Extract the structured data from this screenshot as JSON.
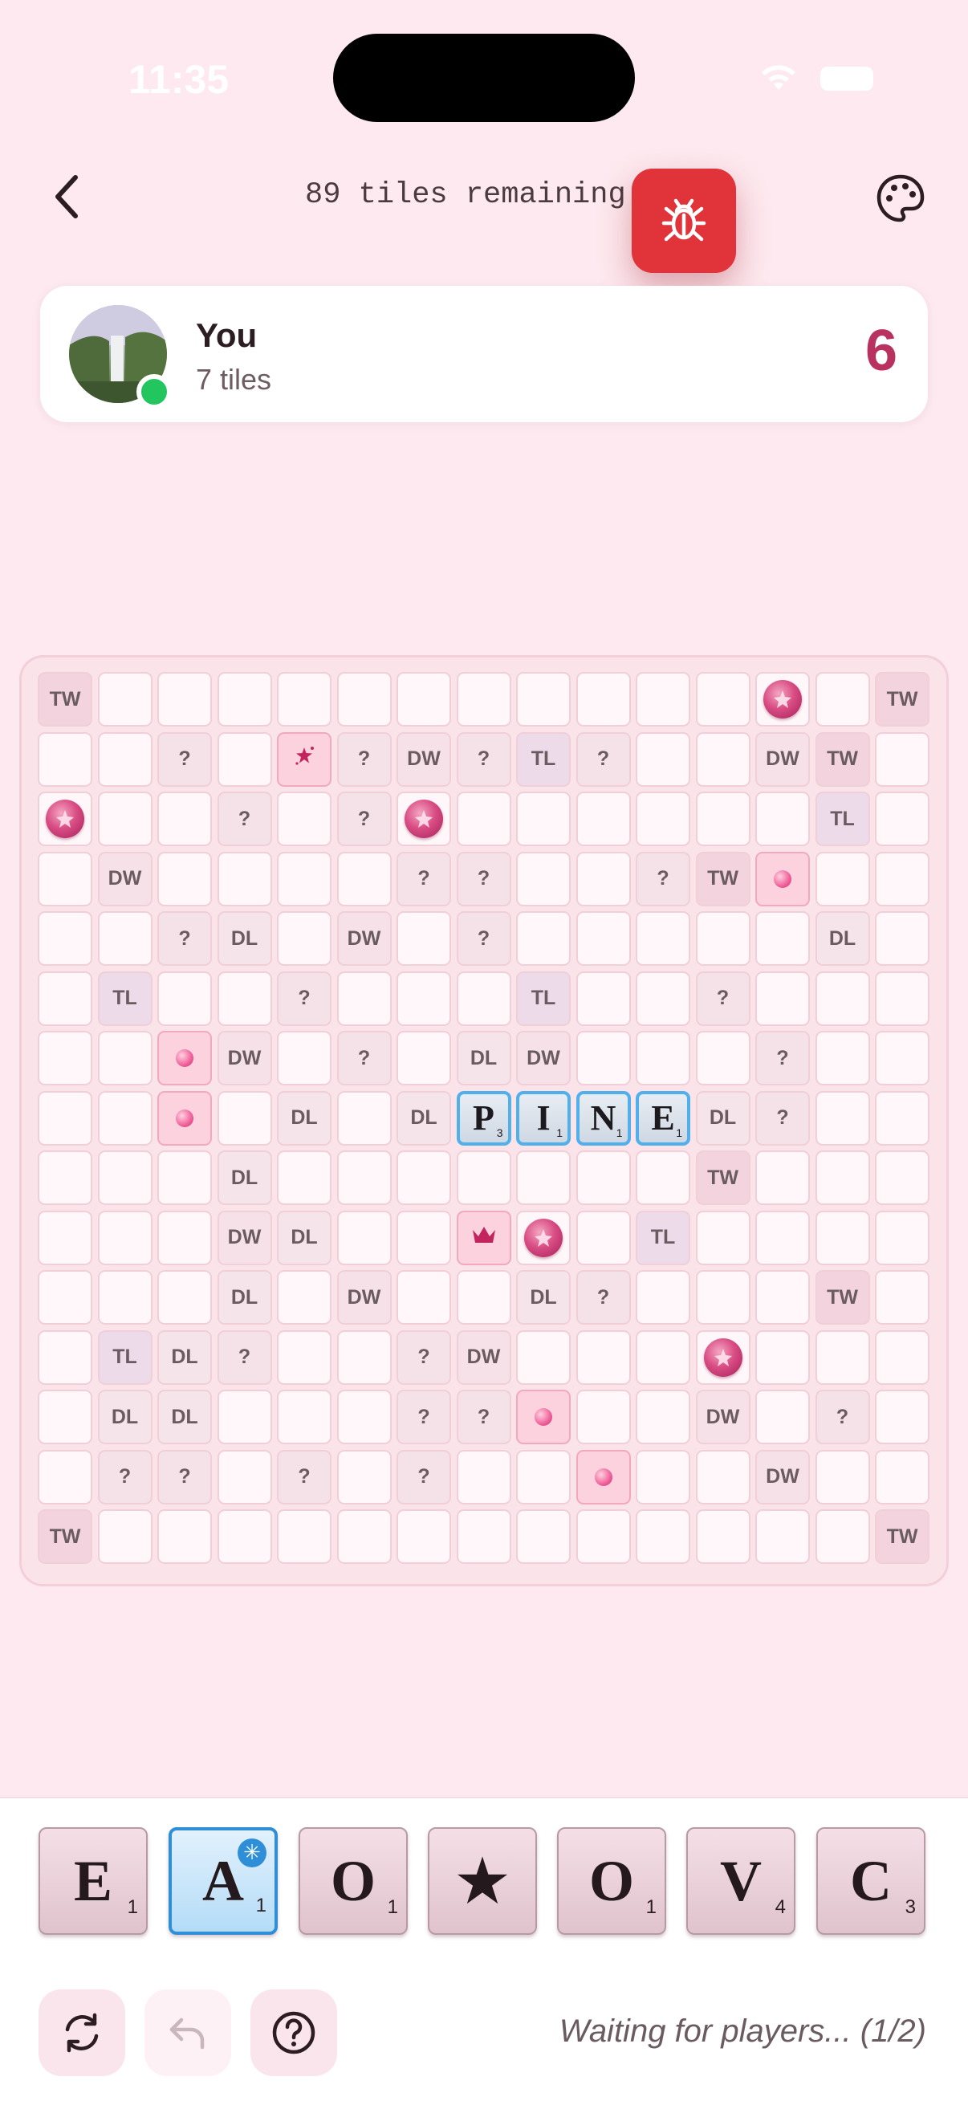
{
  "status": {
    "time": "11:35"
  },
  "header": {
    "tiles_remaining": "89 tiles remaining"
  },
  "player": {
    "name": "You",
    "tiles": "7 tiles",
    "score": "6"
  },
  "board": {
    "premiums": [
      [
        0,
        0,
        "TW"
      ],
      [
        14,
        0,
        "TW"
      ],
      [
        0,
        14,
        "TW"
      ],
      [
        14,
        14,
        "TW"
      ],
      [
        2,
        1,
        "?"
      ],
      [
        5,
        1,
        "?"
      ],
      [
        6,
        1,
        "DW"
      ],
      [
        7,
        1,
        "?"
      ],
      [
        8,
        1,
        "TL"
      ],
      [
        9,
        1,
        "?"
      ],
      [
        12,
        1,
        "DW"
      ],
      [
        13,
        1,
        "TW"
      ],
      [
        3,
        2,
        "?"
      ],
      [
        5,
        2,
        "?"
      ],
      [
        13,
        2,
        "TL"
      ],
      [
        1,
        3,
        "DW"
      ],
      [
        6,
        3,
        "?"
      ],
      [
        7,
        3,
        "?"
      ],
      [
        10,
        3,
        "?"
      ],
      [
        11,
        3,
        "TW"
      ],
      [
        2,
        4,
        "?"
      ],
      [
        3,
        4,
        "DL"
      ],
      [
        5,
        4,
        "DW"
      ],
      [
        7,
        4,
        "?"
      ],
      [
        13,
        4,
        "DL"
      ],
      [
        1,
        5,
        "TL"
      ],
      [
        4,
        5,
        "?"
      ],
      [
        8,
        5,
        "TL"
      ],
      [
        11,
        5,
        "?"
      ],
      [
        3,
        6,
        "DW"
      ],
      [
        5,
        6,
        "?"
      ],
      [
        7,
        6,
        "DL"
      ],
      [
        8,
        6,
        "DW"
      ],
      [
        12,
        6,
        "?"
      ],
      [
        4,
        7,
        "DL"
      ],
      [
        6,
        7,
        "DL"
      ],
      [
        11,
        7,
        "DL"
      ],
      [
        12,
        7,
        "?"
      ],
      [
        3,
        8,
        "DL"
      ],
      [
        11,
        8,
        "TW"
      ],
      [
        3,
        9,
        "DW"
      ],
      [
        4,
        9,
        "DL"
      ],
      [
        10,
        9,
        "TL"
      ],
      [
        3,
        10,
        "DL"
      ],
      [
        5,
        10,
        "DW"
      ],
      [
        8,
        10,
        "DL"
      ],
      [
        9,
        10,
        "?"
      ],
      [
        13,
        10,
        "TW"
      ],
      [
        1,
        11,
        "TL"
      ],
      [
        2,
        11,
        "DL"
      ],
      [
        3,
        11,
        "?"
      ],
      [
        6,
        11,
        "?"
      ],
      [
        7,
        11,
        "DW"
      ],
      [
        1,
        12,
        "DL"
      ],
      [
        2,
        12,
        "DL"
      ],
      [
        6,
        12,
        "?"
      ],
      [
        7,
        12,
        "?"
      ],
      [
        11,
        12,
        "DW"
      ],
      [
        13,
        12,
        "?"
      ],
      [
        1,
        13,
        "?"
      ],
      [
        2,
        13,
        "?"
      ],
      [
        4,
        13,
        "?"
      ],
      [
        6,
        13,
        "?"
      ],
      [
        12,
        13,
        "DW"
      ]
    ],
    "gems": [
      [
        12,
        0
      ],
      [
        0,
        2
      ],
      [
        6,
        2
      ],
      [
        8,
        9
      ],
      [
        11,
        11
      ]
    ],
    "orbs": [
      [
        12,
        3
      ],
      [
        2,
        6
      ],
      [
        2,
        7
      ],
      [
        8,
        12
      ],
      [
        9,
        13
      ]
    ],
    "special": [
      [
        4,
        1,
        "star"
      ],
      [
        7,
        9,
        "crown"
      ]
    ],
    "placed": [
      {
        "col": 7,
        "row": 7,
        "letter": "P",
        "points": "3"
      },
      {
        "col": 8,
        "row": 7,
        "letter": "I",
        "points": "1"
      },
      {
        "col": 9,
        "row": 7,
        "letter": "N",
        "points": "1"
      },
      {
        "col": 10,
        "row": 7,
        "letter": "E",
        "points": "1"
      }
    ]
  },
  "rack": [
    {
      "letter": "E",
      "points": "1"
    },
    {
      "letter": "A",
      "points": "1",
      "selected": true
    },
    {
      "letter": "O",
      "points": "1"
    },
    {
      "letter": "★",
      "points": ""
    },
    {
      "letter": "O",
      "points": "1"
    },
    {
      "letter": "V",
      "points": "4"
    },
    {
      "letter": "C",
      "points": "3"
    }
  ],
  "footer": {
    "waiting": "Waiting for players... (1/2)"
  },
  "icons": {
    "back": "chevron-left-icon",
    "bug": "bug-icon",
    "palette": "palette-icon",
    "shuffle": "refresh-icon",
    "undo": "undo-icon",
    "help": "help-icon"
  },
  "colors": {
    "accent": "#b8315f",
    "bug": "#e0343a",
    "selected": "#2e8fd8",
    "online": "#22c55e"
  }
}
